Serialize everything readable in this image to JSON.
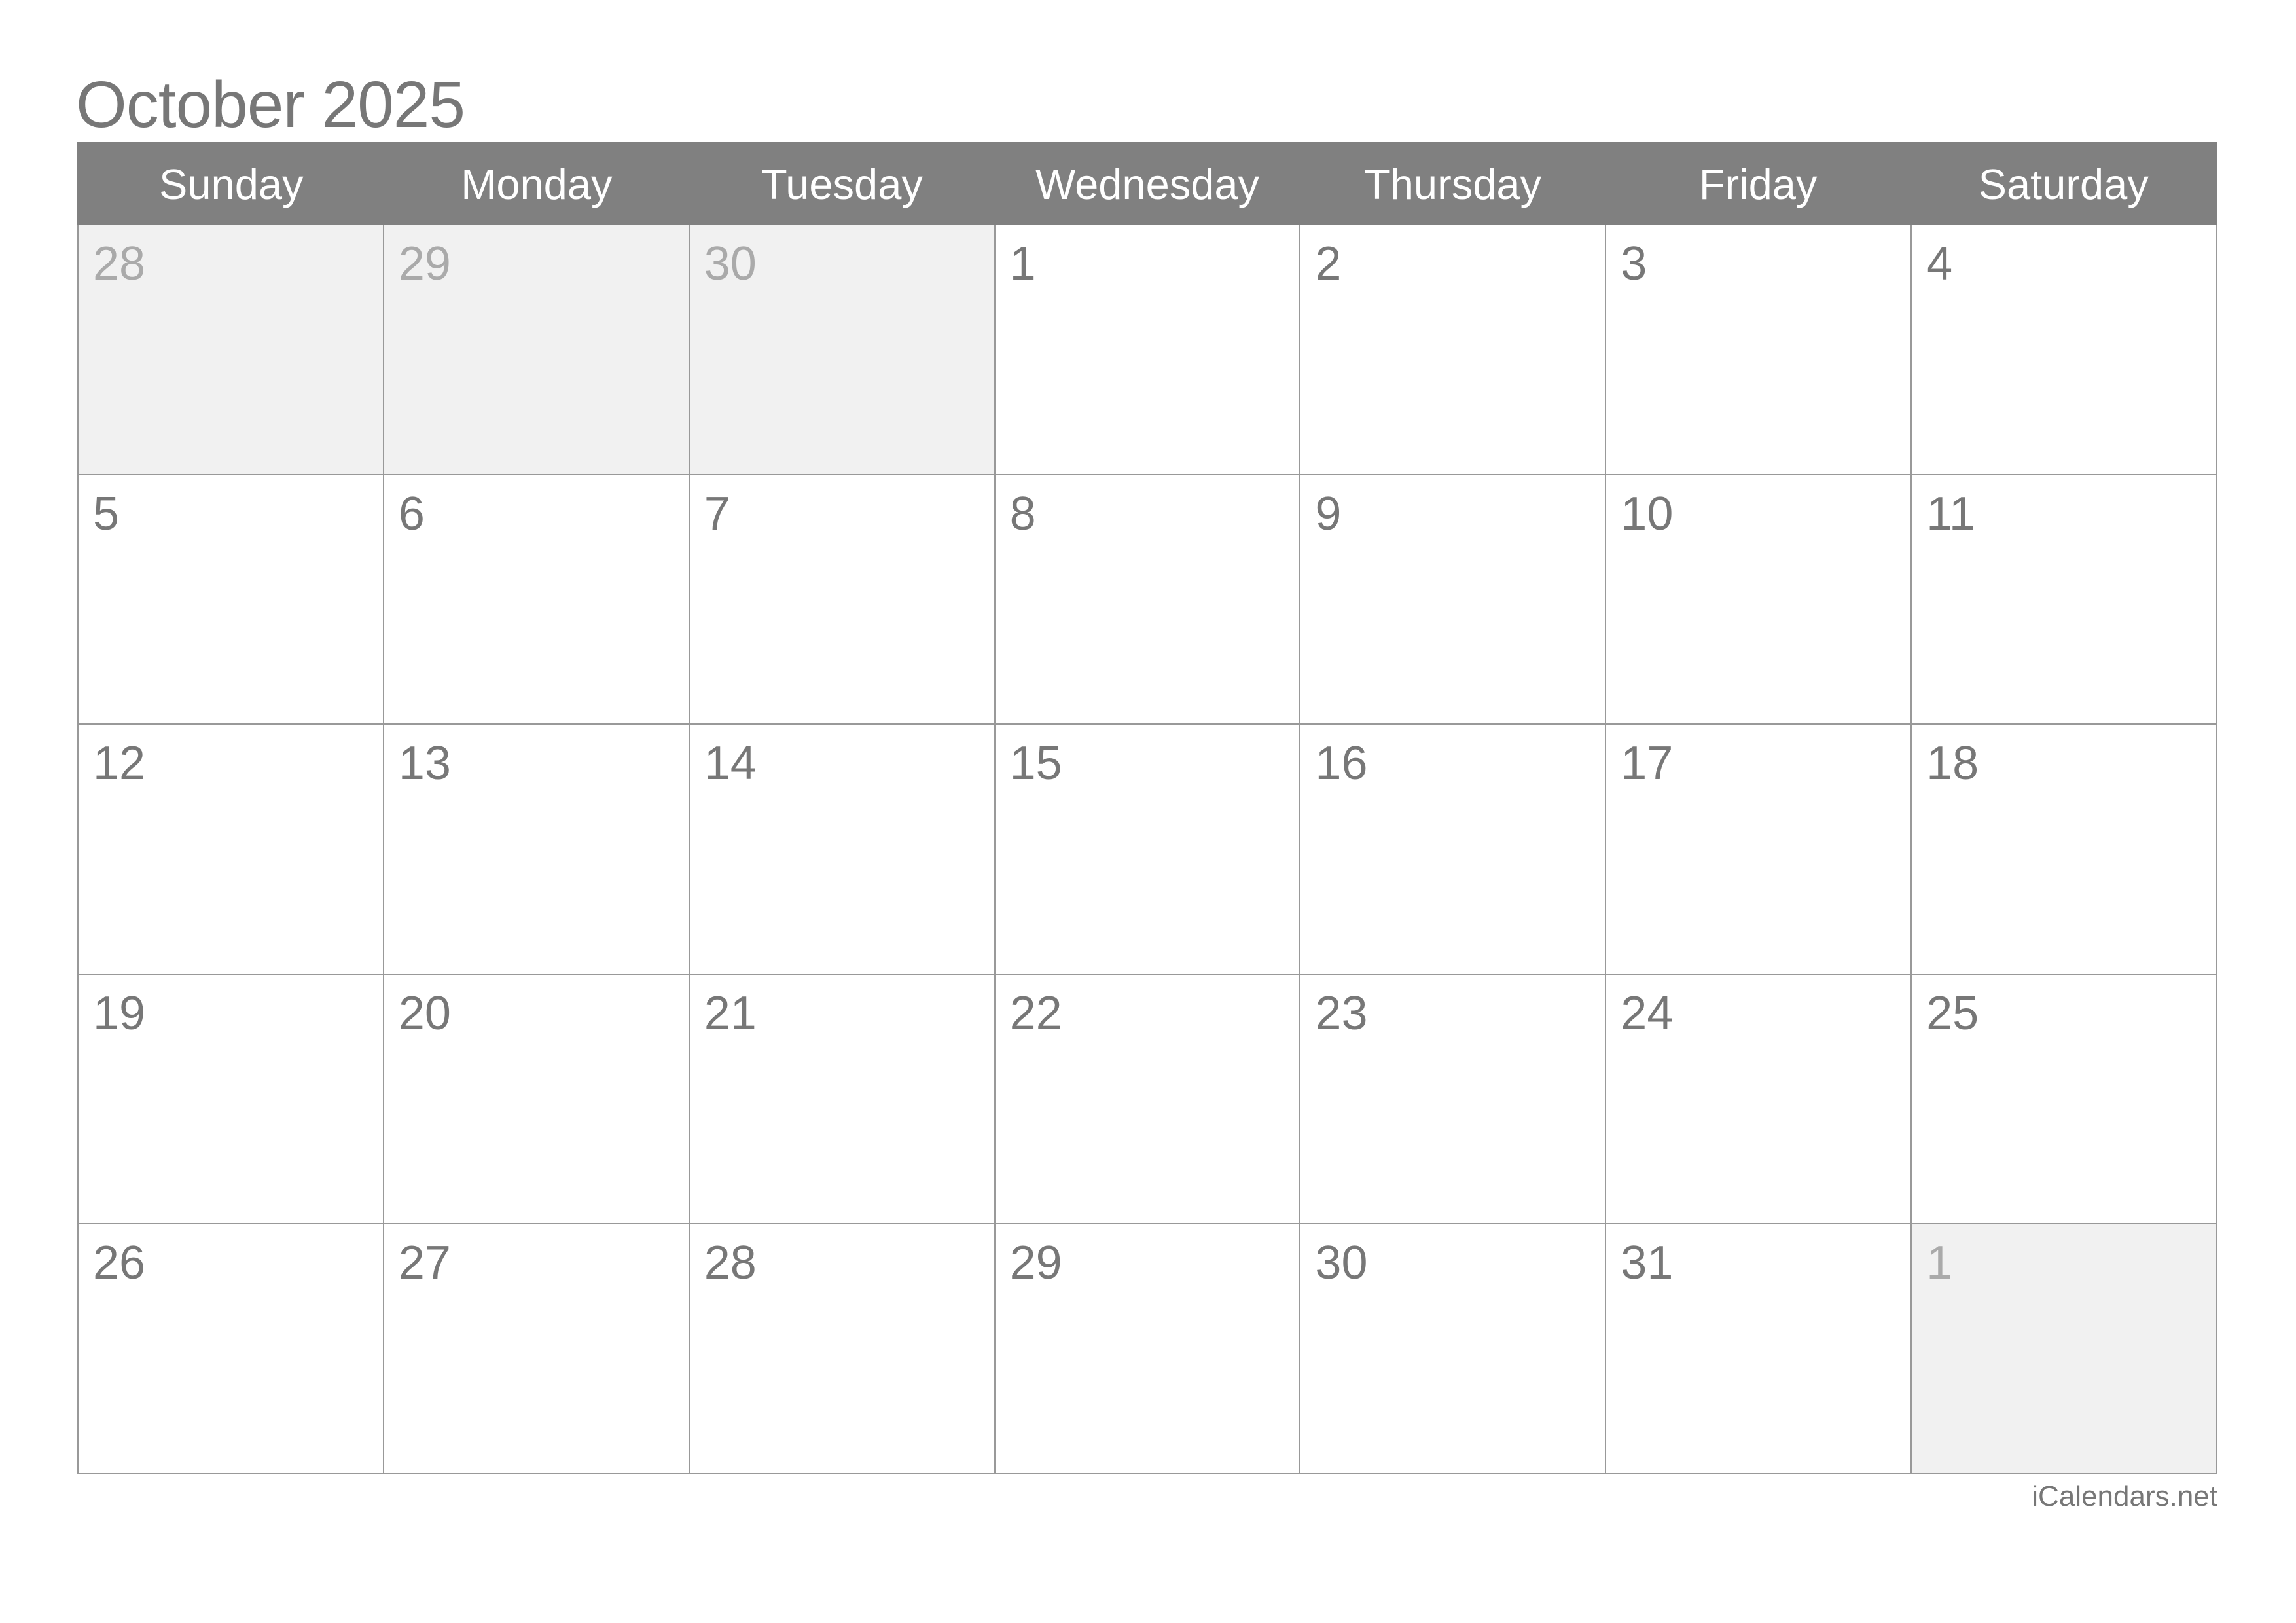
{
  "title": "October 2025",
  "weekdays": [
    "Sunday",
    "Monday",
    "Tuesday",
    "Wednesday",
    "Thursday",
    "Friday",
    "Saturday"
  ],
  "weeks": [
    [
      {
        "day": "28",
        "other": true
      },
      {
        "day": "29",
        "other": true
      },
      {
        "day": "30",
        "other": true
      },
      {
        "day": "1",
        "other": false
      },
      {
        "day": "2",
        "other": false
      },
      {
        "day": "3",
        "other": false
      },
      {
        "day": "4",
        "other": false
      }
    ],
    [
      {
        "day": "5",
        "other": false
      },
      {
        "day": "6",
        "other": false
      },
      {
        "day": "7",
        "other": false
      },
      {
        "day": "8",
        "other": false
      },
      {
        "day": "9",
        "other": false
      },
      {
        "day": "10",
        "other": false
      },
      {
        "day": "11",
        "other": false
      }
    ],
    [
      {
        "day": "12",
        "other": false
      },
      {
        "day": "13",
        "other": false
      },
      {
        "day": "14",
        "other": false
      },
      {
        "day": "15",
        "other": false
      },
      {
        "day": "16",
        "other": false
      },
      {
        "day": "17",
        "other": false
      },
      {
        "day": "18",
        "other": false
      }
    ],
    [
      {
        "day": "19",
        "other": false
      },
      {
        "day": "20",
        "other": false
      },
      {
        "day": "21",
        "other": false
      },
      {
        "day": "22",
        "other": false
      },
      {
        "day": "23",
        "other": false
      },
      {
        "day": "24",
        "other": false
      },
      {
        "day": "25",
        "other": false
      }
    ],
    [
      {
        "day": "26",
        "other": false
      },
      {
        "day": "27",
        "other": false
      },
      {
        "day": "28",
        "other": false
      },
      {
        "day": "29",
        "other": false
      },
      {
        "day": "30",
        "other": false
      },
      {
        "day": "31",
        "other": false
      },
      {
        "day": "1",
        "other": true
      }
    ]
  ],
  "footer": "iCalendars.net",
  "colors": {
    "header_bg": "#808080",
    "header_text": "#ffffff",
    "text": "#777777",
    "muted_text": "#aaaaaa",
    "other_month_bg": "#f1f1f1",
    "grid_line": "#999999"
  }
}
